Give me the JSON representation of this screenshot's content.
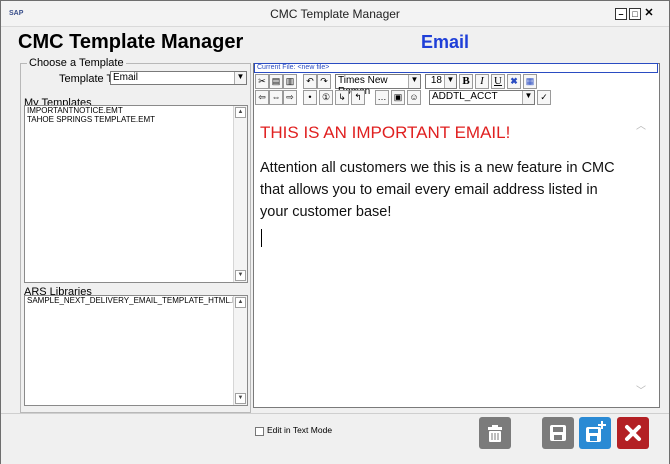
{
  "window": {
    "title": "CMC Template Manager",
    "icon_text": "SAP"
  },
  "header": {
    "app_title": "CMC Template Manager",
    "section_title": "Email"
  },
  "choose_template": {
    "legend": "Choose a Template",
    "template_type_label": "Template Type",
    "template_type_value": "Email"
  },
  "my_templates": {
    "label": "My Templates",
    "items": [
      "IMPORTANTNOTICE.EMT",
      "TAHOE SPRINGS TEMPLATE.EMT"
    ]
  },
  "ars_libraries": {
    "label": "ARS Libraries",
    "items": [
      "SAMPLE_NEXT_DELIVERY_EMAIL_TEMPLATE_HTML.EMT"
    ]
  },
  "editor": {
    "current_file": "Current File: <new file>",
    "font_name": "Times New Roman",
    "font_size": "18",
    "field_select": "ADDTL_ACCT",
    "heading_text": "THIS IS AN IMPORTANT EMAIL!",
    "body_text": "Attention all customers we this is a new feature in CMC that allows you to email every email address listed in your customer base!"
  },
  "bottom": {
    "edit_text_mode_label": "Edit in Text Mode"
  },
  "colors": {
    "accent_blue": "#1f3fd8",
    "heading_red": "#e02020",
    "save_button": "#2a8ad4",
    "close_button": "#b32024"
  }
}
